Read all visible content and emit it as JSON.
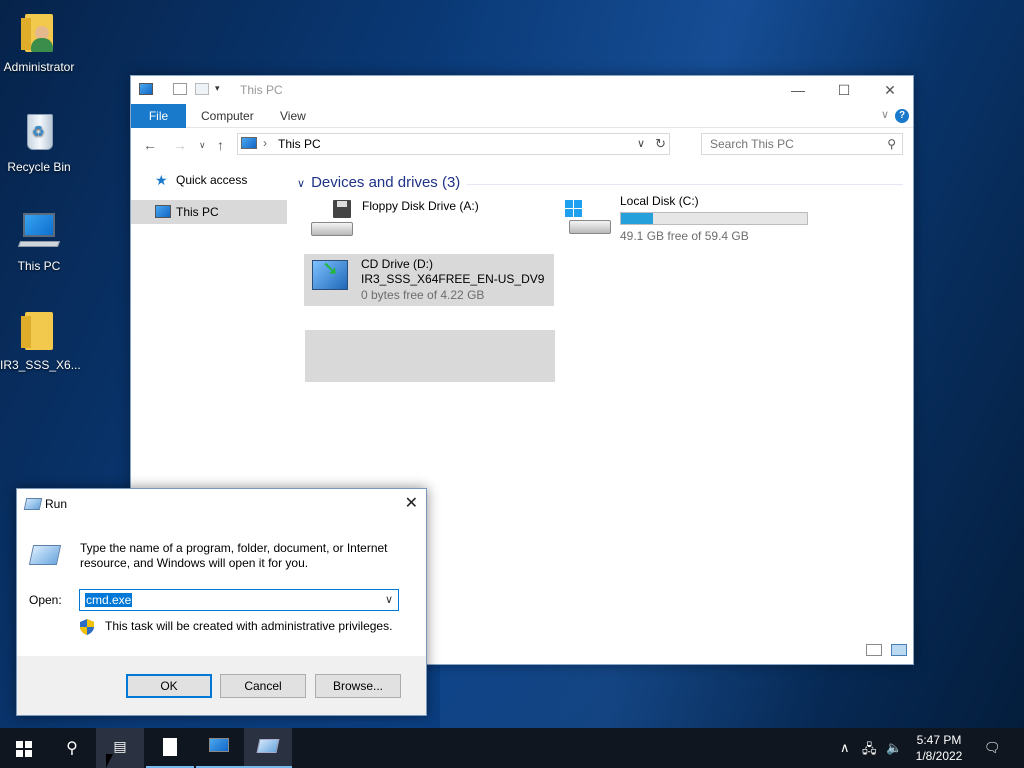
{
  "desktop": {
    "icons": [
      {
        "label": "Administrator"
      },
      {
        "label": "Recycle Bin"
      },
      {
        "label": "This PC"
      },
      {
        "label": "IR3_SSS_X6..."
      }
    ]
  },
  "explorer": {
    "title": "This PC",
    "ribbon_tabs": [
      "File",
      "Computer",
      "View"
    ],
    "help_label": "?",
    "address": "This PC",
    "search_placeholder": "Search This PC",
    "nav": [
      {
        "label": "Quick access"
      },
      {
        "label": "This PC",
        "selected": true
      }
    ],
    "group": {
      "title": "Devices and drives (3)",
      "drives": [
        {
          "name": "Floppy Disk Drive (A:)"
        },
        {
          "name": "Local Disk (C:)",
          "free": "49.1 GB free of 59.4 GB",
          "used_fraction": 0.173
        },
        {
          "name": "CD Drive (D:)",
          "label": "IR3_SSS_X64FREE_EN-US_DV9",
          "free": "0 bytes free of 4.22 GB",
          "selected": true
        }
      ]
    }
  },
  "run": {
    "title": "Run",
    "description": "Type the name of a program, folder, document, or Internet resource, and Windows will open it for you.",
    "open_label": "Open:",
    "open_value": "cmd.exe",
    "admin_note": "This task will be created with administrative privileges.",
    "buttons": {
      "ok": "OK",
      "cancel": "Cancel",
      "browse": "Browse..."
    }
  },
  "taskbar": {
    "time": "5:47 PM",
    "date": "1/8/2022"
  },
  "colors": {
    "accent": "#1979ca",
    "selection": "#0078d7",
    "capacity": "#26a0da",
    "group_header": "#1e3287"
  }
}
